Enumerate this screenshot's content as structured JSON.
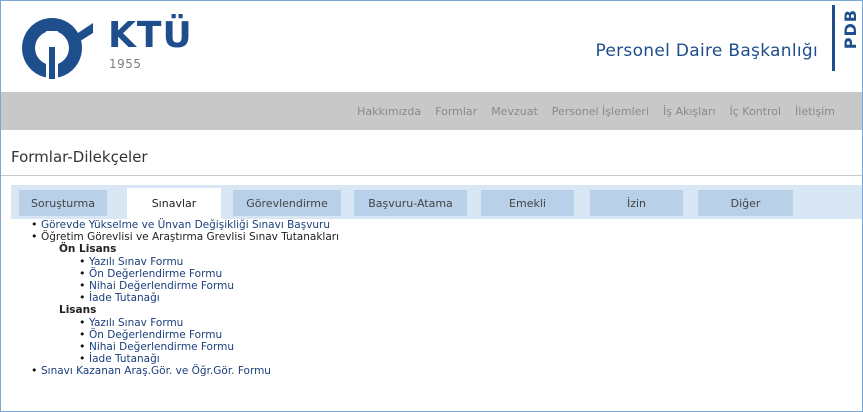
{
  "header": {
    "logo_text": "KTÜ",
    "logo_year": "1955",
    "department": "Personel Daire Başkanlığı",
    "side_label": "PDB",
    "brand_color": "#1f4e8c"
  },
  "nav": {
    "items": [
      "Hakkımızda",
      "Formlar",
      "Mevzuat",
      "Personel İşlemleri",
      "İş Akışları",
      "İç Kontrol",
      "İletişim"
    ]
  },
  "page": {
    "title": "Formlar-Dilekçeler"
  },
  "tabs": {
    "items": [
      "Soruşturma",
      "Sınavlar",
      "Görevlendirme",
      "Başvuru-Atama",
      "Emekli",
      "İzin",
      "Diğer"
    ],
    "active": "Sınavlar"
  },
  "content": {
    "item1": "Görevde Yükselme ve Ünvan Değişikliği Sınavı Başvuru",
    "item2": "Öğretim Görevlisi ve Araştırma Grevlisi Sınav Tutanakları",
    "onlisans": {
      "heading": "Ön Lisans",
      "items": [
        "Yazılı Sınav Formu",
        "Ön Değerlendirme Formu",
        "Nihai Değerlendirme Formu",
        "İade Tutanağı"
      ]
    },
    "lisans": {
      "heading": "Lisans",
      "items": [
        "Yazılı Sınav Formu",
        "Ön Değerlendirme Formu",
        "Nihai Değerlendirme Formu",
        "İade Tutanağı"
      ]
    },
    "item3": "Sınavı Kazanan Araş.Gör. ve Öğr.Gör. Formu"
  }
}
